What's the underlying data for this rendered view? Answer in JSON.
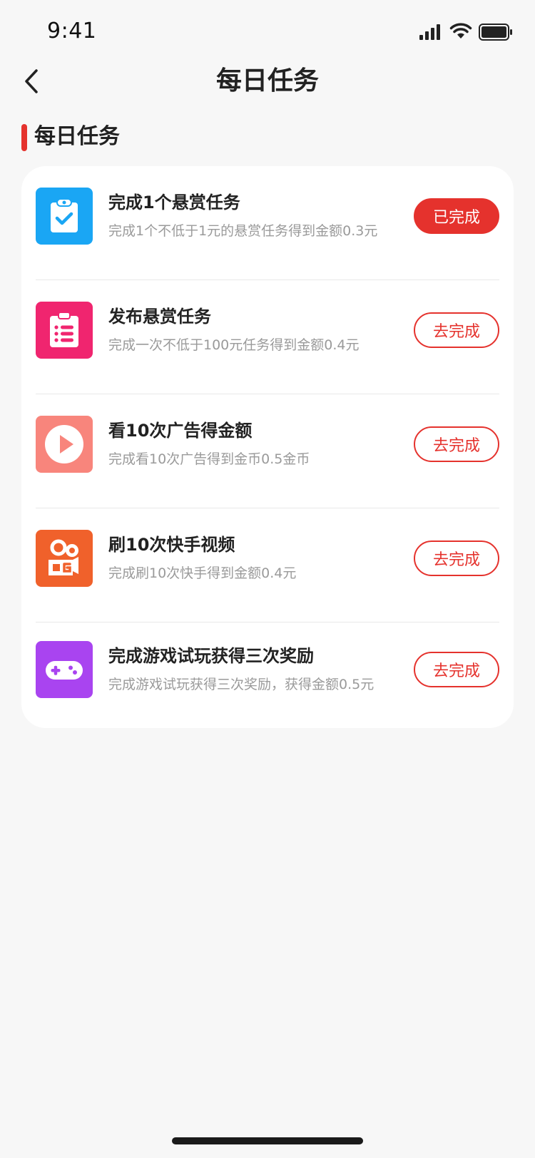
{
  "status_bar": {
    "time": "9:41"
  },
  "header": {
    "title": "每日任务"
  },
  "section": {
    "title": "每日任务"
  },
  "colors": {
    "accent": "#e5322d",
    "background": "#f7f7f7"
  },
  "tasks": [
    {
      "title": "完成1个悬赏任务",
      "desc": "完成1个不低于1元的悬赏任务得到金额0.3元",
      "button": "已完成",
      "status": "done",
      "icon": "clipboard-check-icon",
      "icon_color": "#1aa6f4"
    },
    {
      "title": "发布悬赏任务",
      "desc": "完成一次不低于100元任务得到金额0.4元",
      "button": "去完成",
      "status": "todo",
      "icon": "clipboard-list-icon",
      "icon_color": "#f0256f"
    },
    {
      "title": "看10次广告得金额",
      "desc": "完成看10次广告得到金币0.5金币",
      "button": "去完成",
      "status": "todo",
      "icon": "play-icon",
      "icon_color": "#f8857c"
    },
    {
      "title": "刷10次快手视频",
      "desc": "完成刷10次快手得到金额0.4元",
      "button": "去完成",
      "status": "todo",
      "icon": "kuaishou-camera-icon",
      "icon_color": "#f0612b"
    },
    {
      "title": "完成游戏试玩获得三次奖励",
      "desc": "完成游戏试玩获得三次奖励，获得金额0.5元",
      "button": "去完成",
      "status": "todo",
      "icon": "gamepad-icon",
      "icon_color": "#a944f0"
    }
  ]
}
